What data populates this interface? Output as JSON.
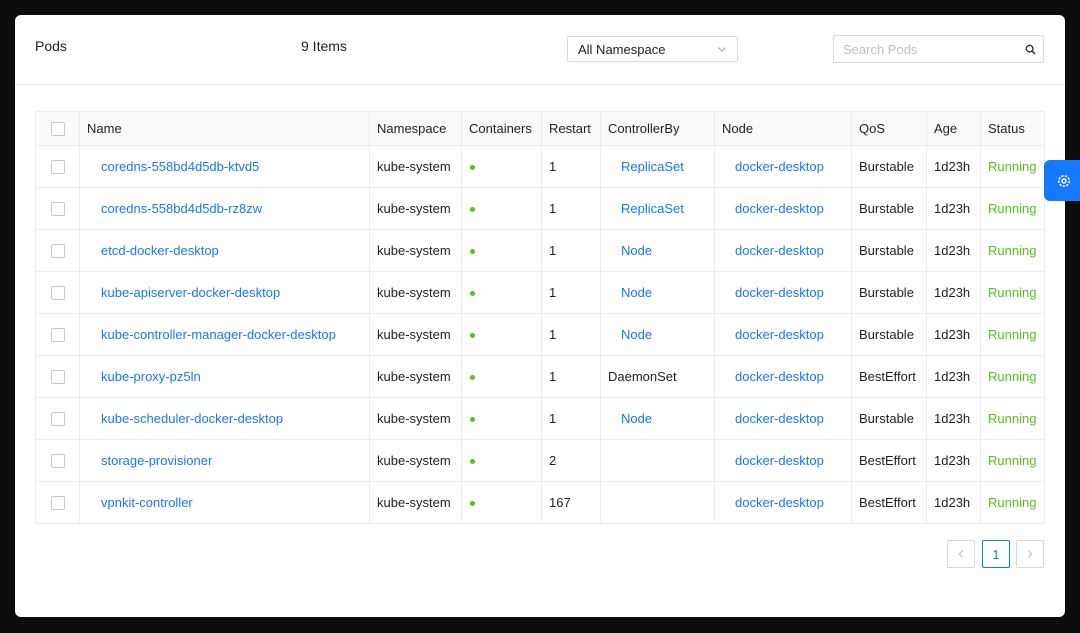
{
  "header": {
    "title": "Pods",
    "count_label": "9 Items",
    "namespace_select": "All Namespace",
    "search_placeholder": "Search Pods"
  },
  "table": {
    "columns": [
      "Name",
      "Namespace",
      "Containers",
      "Restart",
      "ControllerBy",
      "Node",
      "QoS",
      "Age",
      "Status"
    ],
    "rows": [
      {
        "name": "coredns-558bd4d5db-ktvd5",
        "namespace": "kube-system",
        "restart": "1",
        "controller": "ReplicaSet",
        "controller_link": true,
        "node": "docker-desktop",
        "qos": "Burstable",
        "age": "1d23h",
        "status": "Running"
      },
      {
        "name": "coredns-558bd4d5db-rz8zw",
        "namespace": "kube-system",
        "restart": "1",
        "controller": "ReplicaSet",
        "controller_link": true,
        "node": "docker-desktop",
        "qos": "Burstable",
        "age": "1d23h",
        "status": "Running"
      },
      {
        "name": "etcd-docker-desktop",
        "namespace": "kube-system",
        "restart": "1",
        "controller": "Node",
        "controller_link": true,
        "node": "docker-desktop",
        "qos": "Burstable",
        "age": "1d23h",
        "status": "Running"
      },
      {
        "name": "kube-apiserver-docker-desktop",
        "namespace": "kube-system",
        "restart": "1",
        "controller": "Node",
        "controller_link": true,
        "node": "docker-desktop",
        "qos": "Burstable",
        "age": "1d23h",
        "status": "Running"
      },
      {
        "name": "kube-controller-manager-docker-desktop",
        "namespace": "kube-system",
        "restart": "1",
        "controller": "Node",
        "controller_link": true,
        "node": "docker-desktop",
        "qos": "Burstable",
        "age": "1d23h",
        "status": "Running"
      },
      {
        "name": "kube-proxy-pz5ln",
        "namespace": "kube-system",
        "restart": "1",
        "controller": "DaemonSet",
        "controller_link": false,
        "node": "docker-desktop",
        "qos": "BestEffort",
        "age": "1d23h",
        "status": "Running"
      },
      {
        "name": "kube-scheduler-docker-desktop",
        "namespace": "kube-system",
        "restart": "1",
        "controller": "Node",
        "controller_link": true,
        "node": "docker-desktop",
        "qos": "Burstable",
        "age": "1d23h",
        "status": "Running"
      },
      {
        "name": "storage-provisioner",
        "namespace": "kube-system",
        "restart": "2",
        "controller": "",
        "controller_link": false,
        "node": "docker-desktop",
        "qos": "BestEffort",
        "age": "1d23h",
        "status": "Running"
      },
      {
        "name": "vpnkit-controller",
        "namespace": "kube-system",
        "restart": "167",
        "controller": "",
        "controller_link": false,
        "node": "docker-desktop",
        "qos": "BestEffort",
        "age": "1d23h",
        "status": "Running"
      }
    ]
  },
  "pagination": {
    "current_page": "1"
  },
  "icons": {
    "search": "search-icon",
    "dropdown": "chevron-down-icon",
    "prev": "chevron-left-icon",
    "next": "chevron-right-icon",
    "settings": "gear-icon"
  },
  "colors": {
    "accent": "#1677ff",
    "running": "#52c41a",
    "container_dot": "#52c41a"
  }
}
